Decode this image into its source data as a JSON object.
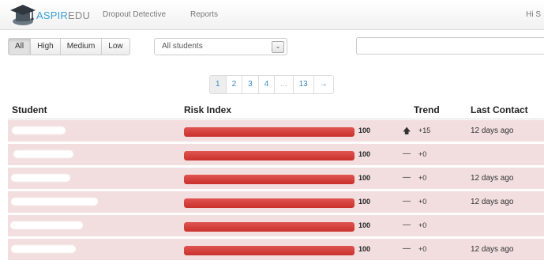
{
  "navbar": {
    "brand_part1": "ASPIR",
    "brand_part2": "EDU",
    "links": [
      "Dropout Detective",
      "Reports"
    ],
    "user_greeting": "Hi S"
  },
  "filters": {
    "risk_levels": [
      "All",
      "High",
      "Medium",
      "Low"
    ],
    "active_level": "All",
    "student_select": "All students",
    "search_value": ""
  },
  "pagination": {
    "pages": [
      "1",
      "2",
      "3",
      "4",
      "...",
      "13",
      "→"
    ],
    "active": "1"
  },
  "table": {
    "headers": {
      "student": "Student",
      "risk": "Risk Index",
      "trend": "Trend",
      "last_contact": "Last Contact"
    },
    "rows": [
      {
        "risk": "100",
        "risk_pct": 100,
        "trend_icon": "arrow-up",
        "trend_glyph": "🡅",
        "trend": "+15",
        "contact": "12 days ago"
      },
      {
        "risk": "100",
        "risk_pct": 100,
        "trend_icon": "dash",
        "trend_glyph": "—",
        "trend": "+0",
        "contact": ""
      },
      {
        "risk": "100",
        "risk_pct": 100,
        "trend_icon": "dash",
        "trend_glyph": "—",
        "trend": "+0",
        "contact": "12 days ago"
      },
      {
        "risk": "100",
        "risk_pct": 100,
        "trend_icon": "dash",
        "trend_glyph": "—",
        "trend": "+0",
        "contact": "12 days ago"
      },
      {
        "risk": "100",
        "risk_pct": 100,
        "trend_icon": "dash",
        "trend_glyph": "—",
        "trend": "+0",
        "contact": ""
      },
      {
        "risk": "100",
        "risk_pct": 100,
        "trend_icon": "dash",
        "trend_glyph": "—",
        "trend": "+0",
        "contact": "12 days ago"
      }
    ]
  },
  "colors": {
    "row_bg": "#f2dede",
    "bar_fill": "#d9534f",
    "link": "#3a87c8",
    "brand_accent": "#3aa0d6"
  }
}
